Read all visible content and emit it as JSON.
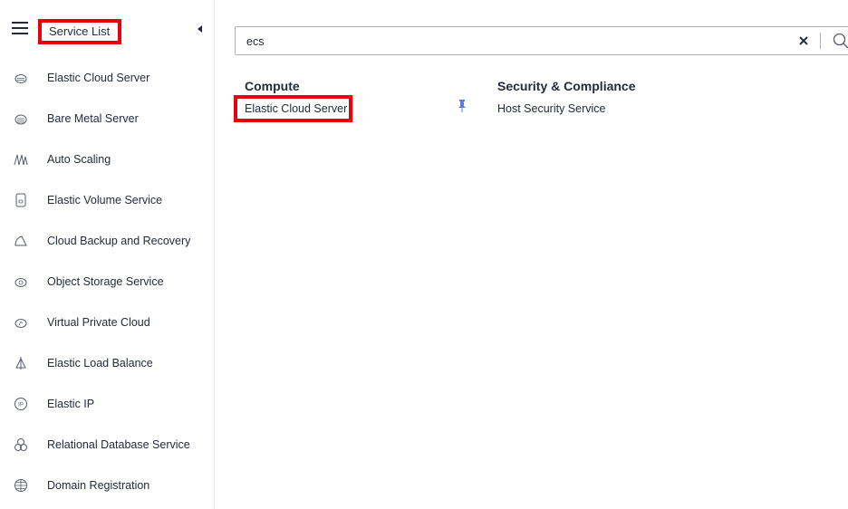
{
  "sidebar": {
    "header_label": "Service List",
    "items": [
      {
        "label": "Elastic Cloud Server",
        "icon": "cloud-server-icon"
      },
      {
        "label": "Bare Metal Server",
        "icon": "bare-metal-icon"
      },
      {
        "label": "Auto Scaling",
        "icon": "auto-scaling-icon"
      },
      {
        "label": "Elastic Volume Service",
        "icon": "volume-icon"
      },
      {
        "label": "Cloud Backup and Recovery",
        "icon": "backup-icon"
      },
      {
        "label": "Object Storage Service",
        "icon": "storage-icon"
      },
      {
        "label": "Virtual Private Cloud",
        "icon": "vpc-icon"
      },
      {
        "label": "Elastic Load Balance",
        "icon": "load-balance-icon"
      },
      {
        "label": "Elastic IP",
        "icon": "ip-icon"
      },
      {
        "label": "Relational Database Service",
        "icon": "database-icon"
      },
      {
        "label": "Domain Registration",
        "icon": "globe-icon"
      }
    ]
  },
  "search": {
    "value": "ecs",
    "placeholder": ""
  },
  "results": {
    "categories": [
      {
        "title": "Compute",
        "items": [
          "Elastic Cloud Server"
        ]
      },
      {
        "title": "Security & Compliance",
        "items": [
          "Host Security Service"
        ]
      }
    ]
  },
  "colors": {
    "highlight": "#e8000b",
    "pin": "#5e7ce0",
    "text": "#252b3a",
    "icon": "#575d6c"
  }
}
